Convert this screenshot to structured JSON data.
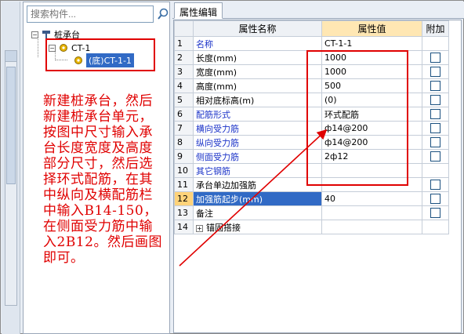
{
  "search": {
    "placeholder": "搜索构件..."
  },
  "tree": {
    "root_label": "桩承台",
    "child_label": "CT-1",
    "grandchild_label": "(底)CT-1-1",
    "expander_minus": "−"
  },
  "annotation": {
    "lines": [
      "新建桩承台，然后",
      "新建桩承台单元，",
      "按图中尺寸输入承",
      "台长度宽度及高度",
      "部分尺寸，然后选",
      "择环式配筋，在其",
      "中纵向及横配筋栏",
      "中输入B14-150，",
      "在侧面受力筋中输",
      "入2B12。然后画图",
      "即可。"
    ],
    "color": "#e00000"
  },
  "tab": {
    "label": "属性编辑"
  },
  "grid": {
    "headers": {
      "name": "属性名称",
      "value": "属性值",
      "extra": "附加"
    },
    "rows": [
      {
        "num": "1",
        "name": "名称",
        "value": "CT-1-1"
      },
      {
        "num": "2",
        "name": "长度(mm)",
        "value": "1000"
      },
      {
        "num": "3",
        "name": "宽度(mm)",
        "value": "1000"
      },
      {
        "num": "4",
        "name": "高度(mm)",
        "value": "500"
      },
      {
        "num": "5",
        "name": "相对底标高(m)",
        "value": "(0)"
      },
      {
        "num": "6",
        "name": "配筋形式",
        "value": "环式配筋"
      },
      {
        "num": "7",
        "name": "横向受力筋",
        "value": "ф14@200"
      },
      {
        "num": "8",
        "name": "纵向受力筋",
        "value": "ф14@200"
      },
      {
        "num": "9",
        "name": "侧面受力筋",
        "value": "2ф12"
      },
      {
        "num": "10",
        "name": "其它钢筋",
        "value": ""
      },
      {
        "num": "11",
        "name": "承台单边加强筋",
        "value": ""
      },
      {
        "num": "12",
        "name": "加强筋起步(mm)",
        "value": "40"
      },
      {
        "num": "13",
        "name": "备注",
        "value": ""
      },
      {
        "num": "14",
        "name": "锚固搭接",
        "value": ""
      }
    ],
    "expand_plus": "+"
  },
  "colors": {
    "accent_red": "#e00000",
    "selection_blue": "#316ac5",
    "header_value_bg": "#ffe7b3",
    "link_blue": "#1b33c8"
  }
}
